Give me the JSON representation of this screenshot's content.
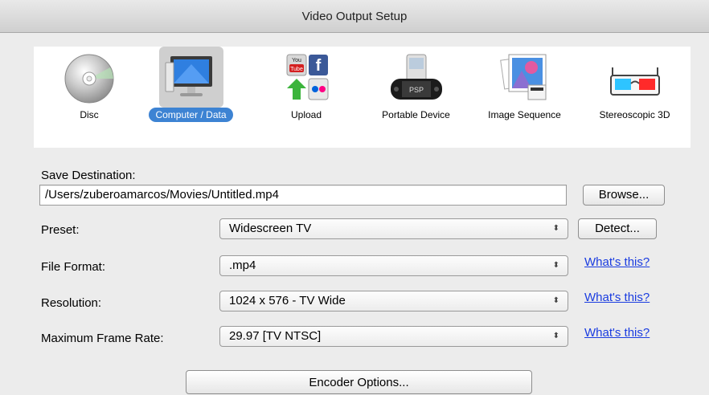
{
  "window": {
    "title": "Video Output Setup"
  },
  "categories": [
    {
      "label": "Disc",
      "icon": "disc-icon",
      "selected": false
    },
    {
      "label": "Computer / Data",
      "icon": "computer-monitor-icon",
      "selected": true
    },
    {
      "label": "Upload",
      "icon": "upload-services-icon",
      "selected": false
    },
    {
      "label": "Portable Device",
      "icon": "psp-device-icon",
      "selected": false
    },
    {
      "label": "Image Sequence",
      "icon": "image-sequence-icon",
      "selected": false
    },
    {
      "label": "Stereoscopic 3D",
      "icon": "3d-glasses-icon",
      "selected": false
    }
  ],
  "upload_icon_text": {
    "youtube": "You Tube",
    "psp": "PSP"
  },
  "save_destination": {
    "label": "Save Destination:",
    "value": "/Users/zuberoamarcos/Movies/Untitled.mp4",
    "browse_label": "Browse..."
  },
  "preset": {
    "label": "Preset:",
    "value": "Widescreen TV",
    "detect_label": "Detect..."
  },
  "file_format": {
    "label": "File Format:",
    "value": ".mp4",
    "help": "What's this?"
  },
  "resolution": {
    "label": "Resolution:",
    "value": "1024 x 576 - TV Wide",
    "help": "What's this?"
  },
  "frame_rate": {
    "label": "Maximum Frame Rate:",
    "value": "29.97 [TV NTSC]",
    "help": "What's this?"
  },
  "encoder_button": {
    "label": "Encoder Options..."
  },
  "colors": {
    "selection": "#3d83d3",
    "link": "#1a3ce0"
  }
}
